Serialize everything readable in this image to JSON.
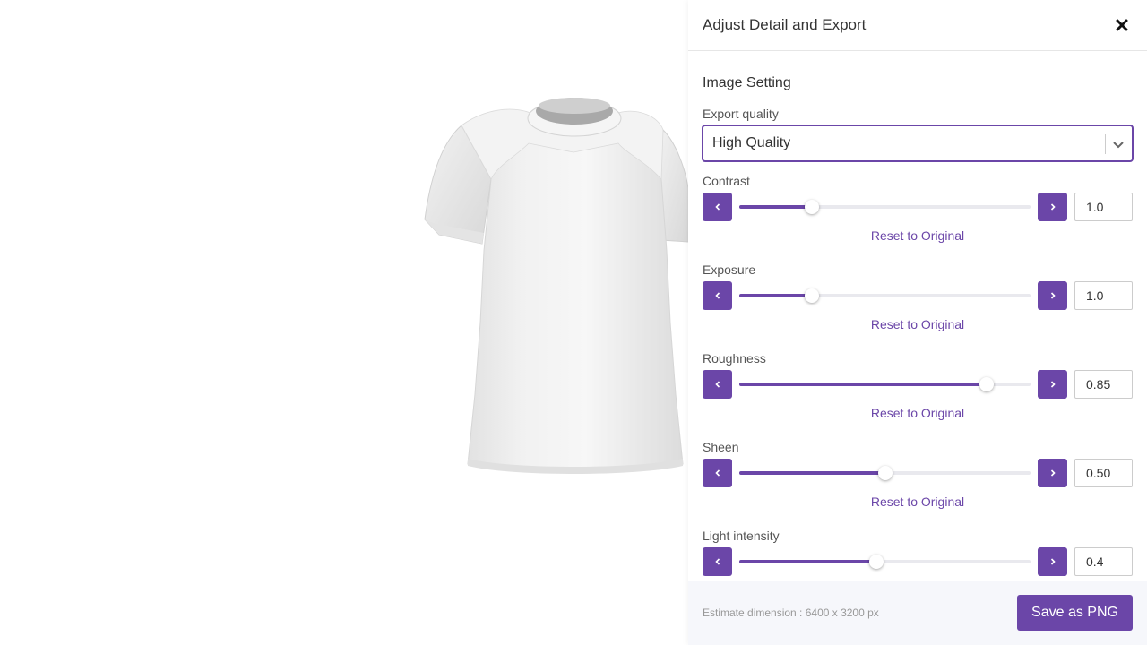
{
  "panel": {
    "title": "Adjust Detail and Export",
    "close_icon": "close-icon",
    "section_title": "Image Setting"
  },
  "export_quality": {
    "label": "Export quality",
    "value": "High Quality"
  },
  "sliders": [
    {
      "label": "Contrast",
      "value": "1.0",
      "fraction": 0.25,
      "reset_label": "Reset to Original"
    },
    {
      "label": "Exposure",
      "value": "1.0",
      "fraction": 0.25,
      "reset_label": "Reset to Original"
    },
    {
      "label": "Roughness",
      "value": "0.85",
      "fraction": 0.85,
      "reset_label": "Reset to Original"
    },
    {
      "label": "Sheen",
      "value": "0.50",
      "fraction": 0.5,
      "reset_label": "Reset to Original"
    },
    {
      "label": "Light intensity",
      "value": "0.4",
      "fraction": 0.47
    }
  ],
  "footer": {
    "estimate": "Estimate dimension : 6400 x 3200 px",
    "save_label": "Save as PNG"
  },
  "colors": {
    "accent": "#6b46a8",
    "track": "#e9e9ee",
    "footer_bg": "#f6f7fb"
  }
}
